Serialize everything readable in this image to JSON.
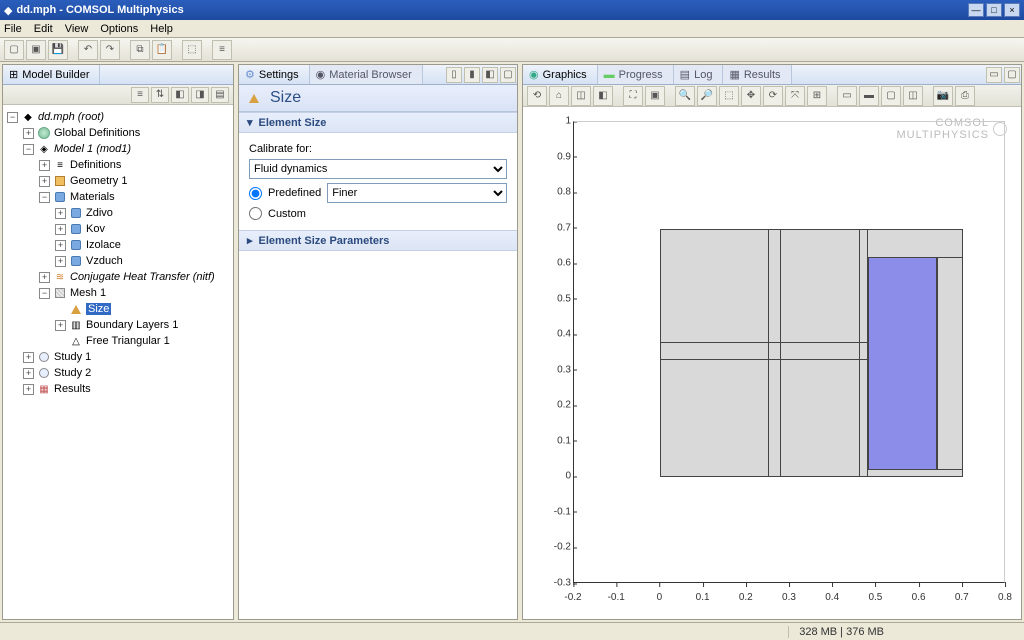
{
  "window": {
    "title": "dd.mph - COMSOL Multiphysics",
    "watermark_l1": "COMSOL",
    "watermark_l2": "MULTIPHYSICS"
  },
  "menu": {
    "file": "File",
    "edit": "Edit",
    "view": "View",
    "options": "Options",
    "help": "Help"
  },
  "left": {
    "tab": "Model Builder",
    "tree": {
      "root": "dd.mph (root)",
      "globaldef": "Global Definitions",
      "model1": "Model 1 (mod1)",
      "definitions": "Definitions",
      "geometry": "Geometry 1",
      "materials": "Materials",
      "mat_zdivo": "Zdivo",
      "mat_kov": "Kov",
      "mat_izolace": "Izolace",
      "mat_vzduch": "Vzduch",
      "cht": "Conjugate Heat Transfer (nitf)",
      "mesh": "Mesh 1",
      "size": "Size",
      "boundary": "Boundary Layers 1",
      "freetri": "Free Triangular 1",
      "study1": "Study 1",
      "study2": "Study 2",
      "results": "Results"
    }
  },
  "mid": {
    "tab_settings": "Settings",
    "tab_matbrowser": "Material Browser",
    "page_title": "Size",
    "sec_elemsize": "Element Size",
    "lbl_calibrate": "Calibrate for:",
    "sel_calibrate": "Fluid dynamics",
    "radio_predefined": "Predefined",
    "sel_predefined": "Finer",
    "radio_custom": "Custom",
    "sec_params": "Element Size Parameters"
  },
  "right": {
    "tab_graphics": "Graphics",
    "tab_progress": "Progress",
    "tab_log": "Log",
    "tab_results": "Results"
  },
  "chart_data": {
    "type": "diagram",
    "xlim": [
      -0.2,
      0.8
    ],
    "ylim": [
      -0.3,
      1.0
    ],
    "xticks": [
      -0.2,
      -0.1,
      0,
      0.1,
      0.2,
      0.3,
      0.4,
      0.5,
      0.6,
      0.7,
      0.8
    ],
    "yticks": [
      -0.3,
      -0.2,
      -0.1,
      0,
      0.1,
      0.2,
      0.3,
      0.4,
      0.5,
      0.6,
      0.7,
      0.8,
      0.9,
      1.0
    ],
    "rects": [
      {
        "x0": 0.0,
        "y0": 0.0,
        "x1": 0.7,
        "y1": 0.7,
        "fill": "gray"
      },
      {
        "x0": 0.0,
        "y0": 0.33,
        "x1": 0.5,
        "y1": 0.38,
        "fill": "gray"
      },
      {
        "x0": 0.25,
        "y0": 0.0,
        "x1": 0.28,
        "y1": 0.7,
        "fill": "line"
      },
      {
        "x0": 0.46,
        "y0": 0.0,
        "x1": 0.48,
        "y1": 0.7,
        "fill": "line"
      },
      {
        "x0": 0.48,
        "y0": 0.02,
        "x1": 0.64,
        "y1": 0.62,
        "fill": "blue"
      },
      {
        "x0": 0.64,
        "y0": 0.02,
        "x1": 0.7,
        "y1": 0.62,
        "fill": "gray"
      }
    ]
  },
  "status": {
    "mem": "328 MB | 376 MB"
  }
}
